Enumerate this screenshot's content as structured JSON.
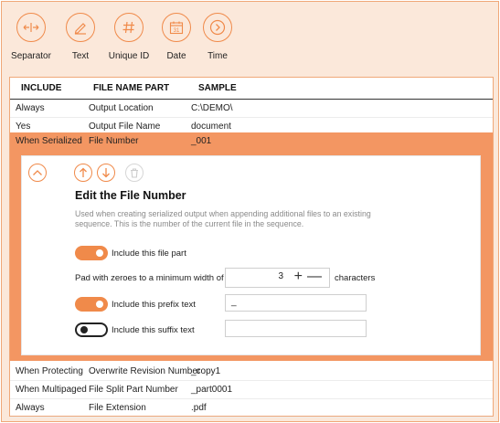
{
  "toolbar": {
    "buttons": [
      {
        "label": "Separator",
        "icon": "separator-arrows-icon"
      },
      {
        "label": "Text",
        "icon": "pencil-icon"
      },
      {
        "label": "Unique ID",
        "icon": "hash-icon"
      },
      {
        "label": "Date",
        "icon": "calendar-icon",
        "calendar_day": "31"
      },
      {
        "label": "Time",
        "icon": "chevron-right-circle-icon"
      }
    ]
  },
  "table": {
    "headers": {
      "include": "INCLUDE",
      "part": "FILE NAME PART",
      "sample": "SAMPLE"
    },
    "rows": [
      {
        "include": "Always",
        "part": "Output Location",
        "sample": "C:\\DEMO\\"
      },
      {
        "include": "Yes",
        "part": "Output File Name",
        "sample": "document"
      },
      {
        "include": "When Serialized",
        "part": "File Number",
        "sample": "_001"
      },
      {
        "include": "When Protecting",
        "part": "Overwrite Revision Number",
        "sample": "_copy1"
      },
      {
        "include": "When Multipaged",
        "part": "File Split Part Number",
        "sample": "_part0001"
      },
      {
        "include": "Always",
        "part": "File Extension",
        "sample": ".pdf"
      }
    ]
  },
  "detail": {
    "title": "Edit the File Number",
    "description": "Used when creating serialized output when appending additional files to an existing sequence. This is the number of the current file in the sequence.",
    "include_part": {
      "label": "Include this file part",
      "on": true
    },
    "pad": {
      "label": "Pad with zeroes to a minimum width of",
      "value": "3",
      "plus": "+",
      "minus": "—",
      "unit": "characters"
    },
    "prefix": {
      "label": "Include this prefix text",
      "on": true,
      "value": "_"
    },
    "suffix": {
      "label": "Include this suffix text",
      "on": false,
      "value": ""
    }
  },
  "colors": {
    "accent": "#f08a4a",
    "selected_row": "#f39662",
    "background": "#fbe8da"
  }
}
